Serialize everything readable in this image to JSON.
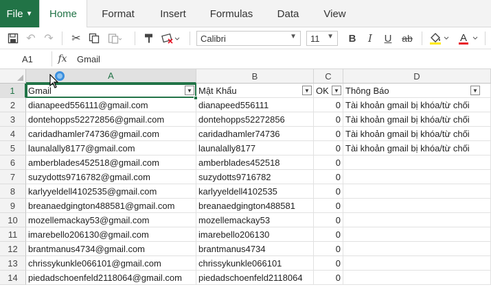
{
  "ribbon": {
    "file_label": "File",
    "tabs": [
      {
        "label": "Home",
        "active": true
      },
      {
        "label": "Format",
        "active": false
      },
      {
        "label": "Insert",
        "active": false
      },
      {
        "label": "Formulas",
        "active": false
      },
      {
        "label": "Data",
        "active": false
      },
      {
        "label": "View",
        "active": false
      }
    ]
  },
  "toolbar": {
    "icons": [
      "save-icon",
      "undo-icon",
      "redo-icon",
      "cut-icon",
      "copy-icon",
      "paste-icon",
      "format-painter-icon",
      "clear-format-icon",
      "bold-icon",
      "italic-icon",
      "underline-icon",
      "strikethrough-icon",
      "fill-color-icon",
      "font-color-icon"
    ],
    "font_name": "Calibri",
    "font_size": "11",
    "bold_label": "B",
    "italic_label": "I",
    "underline_label": "U",
    "strike_label": "ab",
    "font_color_label": "A",
    "accent_color": "#217346",
    "fill_color": "#ffe900",
    "font_color": "#e81123"
  },
  "formula_bar": {
    "cell_ref": "A1",
    "fx_label": "fx",
    "content": "Gmail"
  },
  "grid": {
    "columns": [
      "A",
      "B",
      "C",
      "D"
    ],
    "selected_column": "A",
    "row_numbers": [
      "1",
      "2",
      "3",
      "4",
      "5",
      "6",
      "7",
      "8",
      "9",
      "10",
      "11",
      "12",
      "13",
      "14"
    ],
    "header": [
      "Gmail",
      "Mật Khẩu",
      "OK",
      "Thông Báo"
    ],
    "rows": [
      [
        "dianapeed556111@gmail.com",
        "dianapeed556111",
        "0",
        "Tài khoản gmail bị khóa/từ chối"
      ],
      [
        "dontehopps52272856@gmail.com",
        "dontehopps52272856",
        "0",
        "Tài khoản gmail bị khóa/từ chối"
      ],
      [
        "caridadhamler74736@gmail.com",
        "caridadhamler74736",
        "0",
        "Tài khoản gmail bị khóa/từ chối"
      ],
      [
        "launalally8177@gmail.com",
        "launalally8177",
        "0",
        "Tài khoản gmail bị khóa/từ chối"
      ],
      [
        "amberblades452518@gmail.com",
        "amberblades452518",
        "0",
        ""
      ],
      [
        "suzydotts9716782@gmail.com",
        "suzydotts9716782",
        "0",
        ""
      ],
      [
        "karlyyeldell4102535@gmail.com",
        "karlyyeldell4102535",
        "0",
        ""
      ],
      [
        "breanaedgington488581@gmail.com",
        "breanaedgington488581",
        "0",
        ""
      ],
      [
        "mozellemackay53@gmail.com",
        "mozellemackay53",
        "0",
        ""
      ],
      [
        "imarebello206130@gmail.com",
        "imarebello206130",
        "0",
        ""
      ],
      [
        "brantmanus4734@gmail.com",
        "brantmanus4734",
        "0",
        ""
      ],
      [
        "chrissykunkle066101@gmail.com",
        "chrissykunkle066101",
        "0",
        ""
      ],
      [
        "piedadschoenfeld2118064@gmail.com",
        "piedadschoenfeld2118064",
        "0",
        ""
      ]
    ]
  }
}
